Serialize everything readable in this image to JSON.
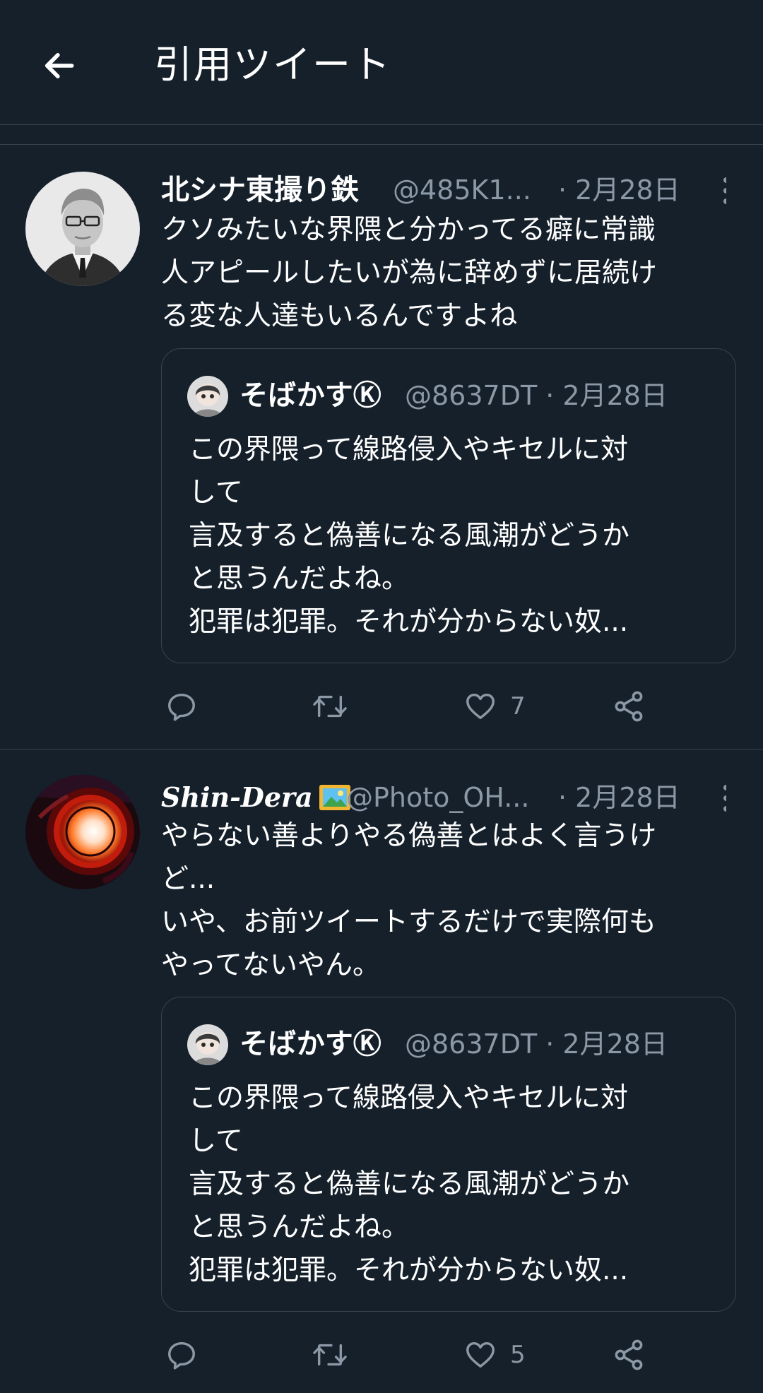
{
  "header": {
    "title": "引用ツイート"
  },
  "tweets": [
    {
      "name": "北シナ東撮り鉄",
      "handle": "@485K1...",
      "date": "· 2月28日",
      "text": "クソみたいな界隈と分かってる癖に常識\n人アピールしたいが為に辞めずに居続け\nる変な人達もいるんですよね",
      "quote": {
        "name": "そばかすⓀ",
        "meta": "@8637DT · 2月28日",
        "text": "この界隈って線路侵入やキセルに対\nして\n言及すると偽善になる風潮がどうか\nと思うんだよね。\n犯罪は犯罪。それが分からない奴..."
      },
      "like_count": "7"
    },
    {
      "name": "Shin-Dera",
      "handle": "@Photo_OH...",
      "date": "· 2月28日",
      "text": "やらない善よりやる偽善とはよく言うけ\nど...\nいや、お前ツイートするだけで実際何も\nやってないやん。",
      "quote": {
        "name": "そばかすⓀ",
        "meta": "@8637DT · 2月28日",
        "text": "この界隈って線路侵入やキセルに対\nして\n言及すると偽善になる風潮がどうか\nと思うんだよね。\n犯罪は犯罪。それが分からない奴..."
      },
      "like_count": "5"
    }
  ],
  "icons": {
    "back": "arrow-left-icon",
    "more": "more-vertical-icon",
    "reply": "reply-icon",
    "retweet": "retweet-icon",
    "like": "heart-icon",
    "share": "share-icon"
  },
  "colors": {
    "background": "#15202b",
    "border": "#38444d",
    "secondary_text": "#8b98a5",
    "primary_text": "#ffffff"
  }
}
